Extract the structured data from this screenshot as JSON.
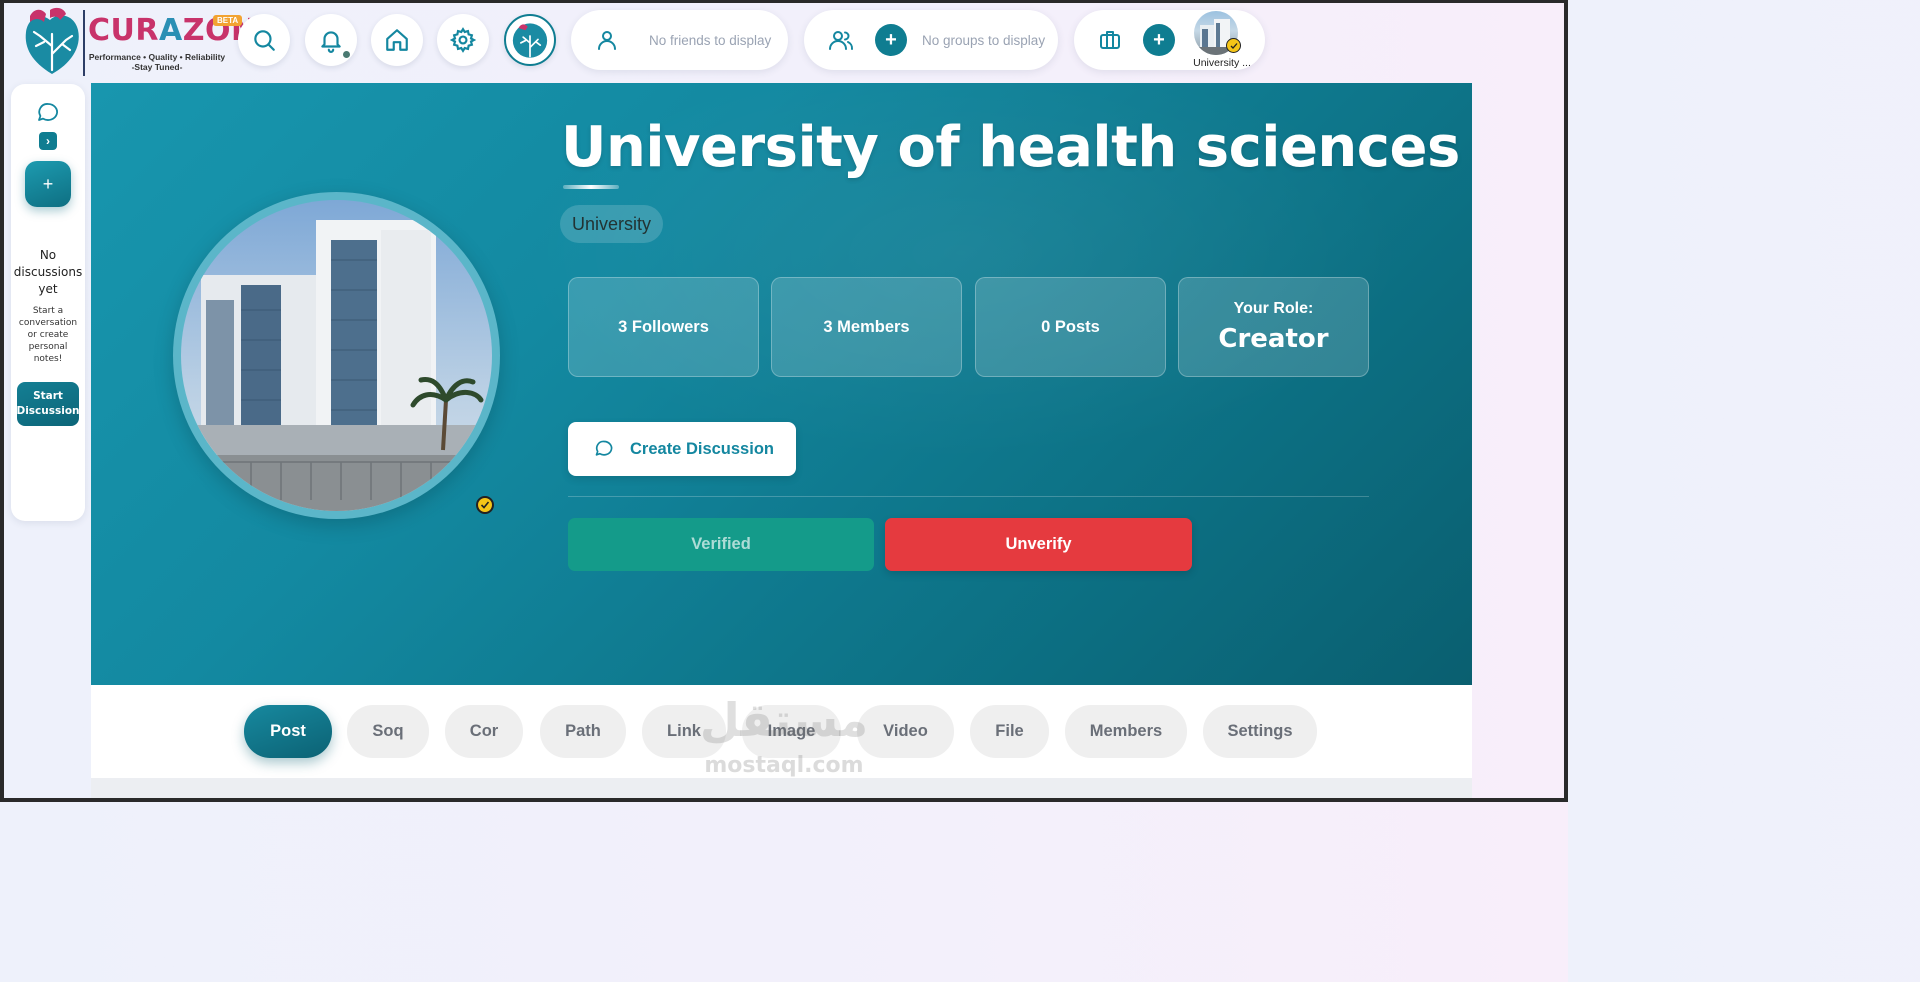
{
  "brand": {
    "name_part1": "CUR",
    "name_part2": "A",
    "name_part3": "ZON",
    "beta": "BETA",
    "tagline_line1": "Performance • Quality • Reliability",
    "tagline_line2": "-Stay Tuned-",
    "accent": "#0f7d91"
  },
  "topbar": {
    "icons": [
      "search-icon",
      "bell-icon",
      "home-icon",
      "gear-icon",
      "app-logo-icon"
    ],
    "friends": {
      "empty_text": "No friends to display"
    },
    "groups": {
      "empty_text": "No groups to display"
    },
    "organization": {
      "label": "University ..."
    }
  },
  "sidebar": {
    "empty_title": "No discussions yet",
    "empty_sub": "Start a conversation or create personal notes!",
    "start_label": "Start Discussion",
    "plus": "+",
    "chevron": "›"
  },
  "hero": {
    "title": "University of health sciences",
    "type": "University",
    "stats": {
      "followers": "3 Followers",
      "members": "3 Members",
      "posts": "0 Posts"
    },
    "role_label": "Your Role:",
    "role_value": "Creator",
    "create_discussion": "Create Discussion",
    "verified": "Verified",
    "unverify": "Unverify"
  },
  "tabs": [
    "Post",
    "Soq",
    "Cor",
    "Path",
    "Link",
    "Image",
    "Video",
    "File",
    "Members",
    "Settings"
  ],
  "active_tab": "Post",
  "watermark": {
    "arabic": "مستقل",
    "latin": "mostaql.com"
  }
}
